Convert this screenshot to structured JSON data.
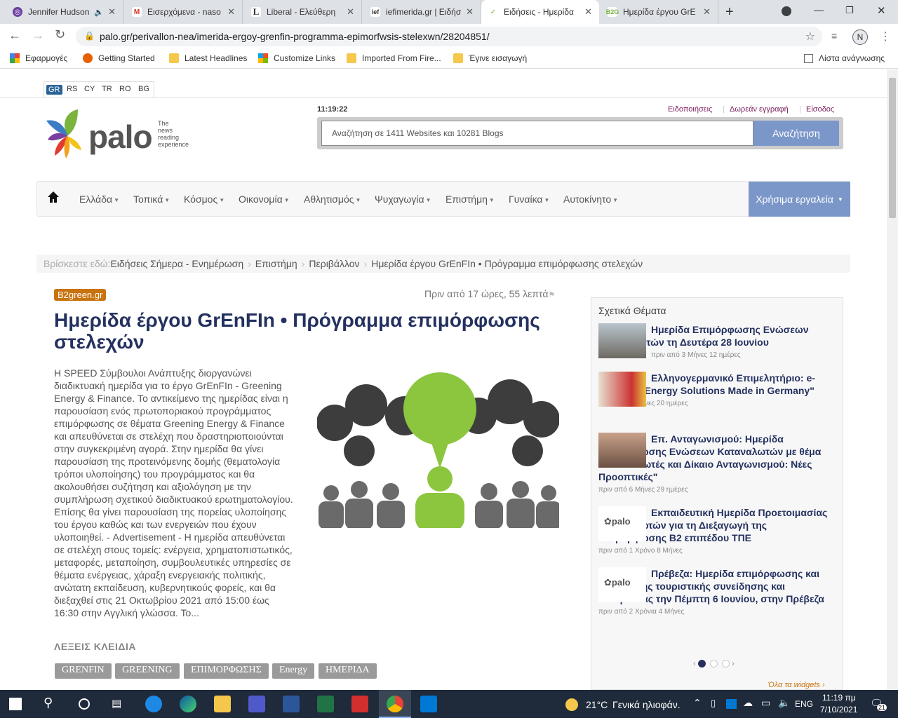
{
  "browser": {
    "tabs": [
      {
        "label": "Jennifer Hudson",
        "active": false
      },
      {
        "label": "Εισερχόμενα - naso",
        "active": false
      },
      {
        "label": "Liberal - Ελεύθερη",
        "active": false
      },
      {
        "label": "iefimerida.gr | Ειδήσ",
        "active": false
      },
      {
        "label": "Ειδήσεις - Ημερίδα",
        "active": true
      },
      {
        "label": "Ημερίδα έργου GrE",
        "active": false
      }
    ],
    "url": "palo.gr/perivallon-nea/imerida-ergoy-grenfin-programma-epimorfwsis-stelexwn/28204851/",
    "profile_initial": "N",
    "bookmarks": [
      "Εφαρμογές",
      "Getting Started",
      "Latest Headlines",
      "Customize Links",
      "Imported From Fire...",
      "Έγινε εισαγωγή"
    ],
    "reading_list": "Λίστα ανάγνωσης"
  },
  "site": {
    "languages": [
      "GR",
      "RS",
      "CY",
      "TR",
      "RO",
      "BG"
    ],
    "logo": {
      "name": "palo",
      "tagline_1": "The",
      "tagline_2": "news",
      "tagline_3": "reading",
      "tagline_4": "experience"
    },
    "clock": "11:19:22",
    "top_links": [
      "Ειδοποιήσεις",
      "Δωρεάν εγγραφή",
      "Είσοδος"
    ],
    "search_placeholder": "Αναζήτηση σε 1411 Websites και 10281 Blogs",
    "search_button": "Αναζήτηση",
    "nav": [
      "Ελλάδα",
      "Τοπικά",
      "Κόσμος",
      "Οικονομία",
      "Αθλητισμός",
      "Ψυχαγωγία",
      "Επιστήμη",
      "Γυναίκα",
      "Αυτοκίνητο"
    ],
    "tools": "Χρήσιμα εργαλεία",
    "breadcrumb_prefix": "Βρίσκεστε εδώ:",
    "breadcrumb": [
      "Ειδήσεις Σήμερα - Ενημέρωση",
      "Επιστήμη",
      "Περιβάλλον",
      "Ημερίδα έργου GrEnFIn • Πρόγραμμα επιμόρφωσης στελεχών"
    ]
  },
  "article": {
    "source": "B2green.gr",
    "ago": "Πριν από 17 ώρες, 55 λεπτά",
    "title": "Ημερίδα έργου GrEnFIn • Πρόγραμμα επιμόρφωσης στελεχών",
    "body": "Η SPEED Σύμβουλοι Ανάπτυξης διοργανώνει διαδικτυακή ημερίδα για το έργο GrEnFIn - Greening Energy & Finance. Το αντικείμενο της ημερίδας είναι η παρουσίαση ενός πρωτοποριακού προγράμματος επιμόρφωσης σε θέματα Greening Energy & Finance και απευθύνεται σε στελέχη που δραστηριοποιούνται στην συγκεκριμένη αγορά. Στην ημερίδα θα γίνει παρουσίαση της προτεινόμενης δομής (θεματολογία τρόποι υλοποίησης) του προγράμματος και θα ακολουθήσει συζήτηση και αξιολόγηση με την συμπλήρωση σχετικού διαδικτυακού ερωτηματολογίου. Επίσης θα γίνει παρουσίαση της πορείας υλοποίησης του έργου καθώς και των ενεργειών που έχουν υλοποιηθεί. - Advertisement - Η ημερίδα απευθύνεται σε στελέχη στους τομείς: ενέργεια, χρηματοπιστωτικός, μεταφορές, μεταποίηση, συμβουλευτικές υπηρεσίες σε θέματα ενέργειας, χάραξη ενεργειακής πολιτικής, ανώτατη εκπαίδευση, κυβερνητικούς φορείς, και θα διεξαχθεί στις 21 Οκτωβρίου 2021 από 15:00 έως 16:30 στην Αγγλική γλώσσα. Το...",
    "keywords_label": "ΛΕΞΕΙΣ ΚΛΕΙΔΙΑ",
    "keywords": [
      "GRENFIN",
      "GREENING",
      "ΕΠΙΜΟΡΦΩΣΗΣ",
      "Energy",
      "ΗΜΕΡΙΔΑ"
    ]
  },
  "related": {
    "heading": "Σχετικά Θέματα",
    "items": [
      {
        "title": "Ημερίδα Επιμόρφωσης Ενώσεων Καταναλωτών τη Δευτέρα 28 Ιουνίου",
        "time": "πριν από 3 Μήνες 12 ημέρες"
      },
      {
        "title": "Ελληνογερμανικό Επιμελητήριο: e-Ημερίδα \"Energy Solutions Made in Germany\"",
        "time": "πριν από 3 Μήνες 20 ημέρες"
      },
      {
        "title": "Επ. Ανταγωνισμού: Ημερίδα Επιμόρφωσης Ενώσεων Καταναλωτών με θέμα \"Καταναλωτές και Δίκαιο Ανταγωνισμού: Νέες Προοπτικές\"",
        "time": "πριν από 6 Μήνες 29 ημέρες"
      },
      {
        "title": "Εκπαιδευτική Ημερίδα Προετοιμασίας Επιμορφωτών για τη Διεξαγωγή της Επιμόρφωσης Β2 επιπέδου ΤΠΕ",
        "time": "πριν από 1 Χρόνο 8 Μήνες"
      },
      {
        "title": "Πρέβεζα: Ημερίδα επιμόρφωσης και διαχείρισης τουριστικής συνείδησης και νοοτροπίας την Πέμπτη 6 Ιουνίου, στην Πρέβεζα",
        "time": "πριν από 2 Χρόνια 4 Μήνες"
      }
    ],
    "all_widgets": "Όλα τα widgets ›"
  },
  "taskbar": {
    "temperature": "21°C",
    "weather": "Γενικά ηλιοφάν.",
    "lang": "ENG",
    "time": "11:19 πμ",
    "date": "7/10/2021",
    "notifications": "21"
  }
}
